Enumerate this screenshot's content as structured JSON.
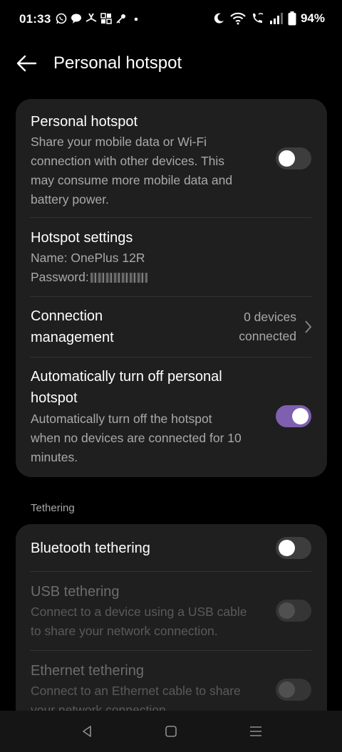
{
  "status_bar": {
    "time": "01:33",
    "battery": "94%",
    "left_icons": [
      "whatsapp-icon",
      "chat-bubble-icon",
      "fan-icon",
      "app-grid-icon",
      "key-icon",
      "dot-icon"
    ],
    "right_icons": [
      "moon-icon",
      "wifi-icon",
      "wifi-calling-icon",
      "signal-icon",
      "battery-icon"
    ]
  },
  "header": {
    "title": "Personal hotspot"
  },
  "hotspot_card": {
    "personal_hotspot": {
      "title": "Personal hotspot",
      "description_line1": "Share your mobile data or Wi-Fi",
      "description_line2": "connection with other devices. This",
      "description_line3": "may consume more mobile data and",
      "description_line4": "battery power.",
      "enabled": false
    },
    "hotspot_settings": {
      "title": "Hotspot settings",
      "name": "Name: OnePlus 12R",
      "password_label": "Password:"
    },
    "connection_management": {
      "title_line1": "Connection",
      "title_line2": "management",
      "value_line1": "0 devices",
      "value_line2": "connected"
    },
    "auto_turn_off": {
      "title_line1": "Automatically turn off personal",
      "title_line2": "hotspot",
      "description_line1": "Automatically turn off the hotspot",
      "description_line2": "when no devices are connected for 10",
      "description_line3": "minutes.",
      "enabled": true
    }
  },
  "tethering": {
    "section_label": "Tethering",
    "bluetooth": {
      "title": "Bluetooth tethering",
      "enabled": false
    },
    "usb": {
      "title": "USB tethering",
      "description_line1": "Connect to a device using a USB cable",
      "description_line2": "to share your network connection.",
      "enabled": false,
      "disabled": true
    },
    "ethernet": {
      "title": "Ethernet tethering",
      "description_line1": "Connect to an Ethernet cable to share",
      "description_line2": "your network connection",
      "enabled": false,
      "disabled": true
    }
  },
  "nav_bar": {
    "icons": [
      "back-triangle-icon",
      "home-square-icon",
      "recents-menu-icon"
    ]
  },
  "colors": {
    "background": "#000000",
    "card": "#1f1f1f",
    "accent": "#7e5fb0",
    "secondary_text": "#a9a9a9"
  }
}
